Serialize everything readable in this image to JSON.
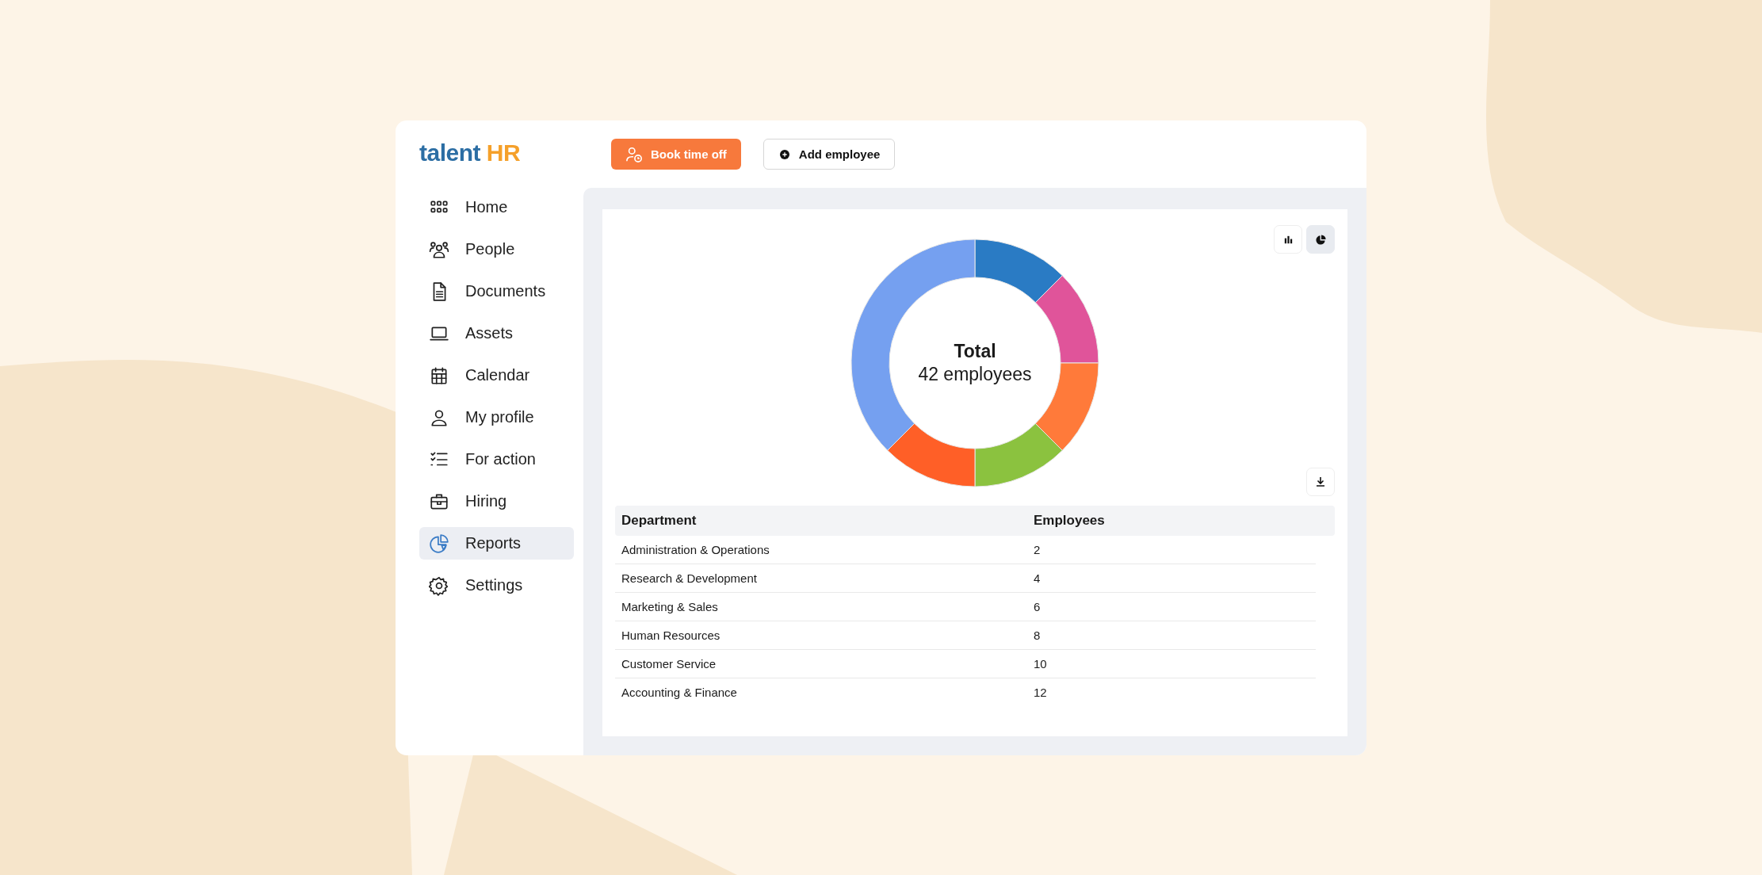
{
  "logo": {
    "text": "talent",
    "accent": "HR"
  },
  "toolbar": {
    "buttons": [
      {
        "label": "Book time off",
        "kind": "primary"
      },
      {
        "label": "Add employee",
        "kind": "secondary"
      }
    ]
  },
  "sidebar": {
    "items": [
      {
        "label": "Home",
        "selected": false
      },
      {
        "label": "People",
        "selected": false
      },
      {
        "label": "Documents",
        "selected": false
      },
      {
        "label": "Assets",
        "selected": false
      },
      {
        "label": "Calendar",
        "selected": false
      },
      {
        "label": "My profile",
        "selected": false
      },
      {
        "label": "For action",
        "selected": false
      },
      {
        "label": "Hiring",
        "selected": false
      },
      {
        "label": "Reports",
        "selected": true
      },
      {
        "label": "Settings",
        "selected": false
      }
    ]
  },
  "chart_panel": {
    "view_toggle": [
      {
        "kind": "bar",
        "selected": false
      },
      {
        "kind": "pie",
        "selected": true
      }
    ],
    "center_title": "Total",
    "center_value": "42 employees"
  },
  "table": {
    "columns": [
      "Department",
      "Employees"
    ],
    "rows": [
      [
        "Administration & Operations",
        "2"
      ],
      [
        "Research & Development",
        "4"
      ],
      [
        "Marketing & Sales",
        "6"
      ],
      [
        "Human Resources",
        "8"
      ],
      [
        "Customer Service",
        "10"
      ],
      [
        "Accounting & Finance",
        "12"
      ]
    ]
  }
}
